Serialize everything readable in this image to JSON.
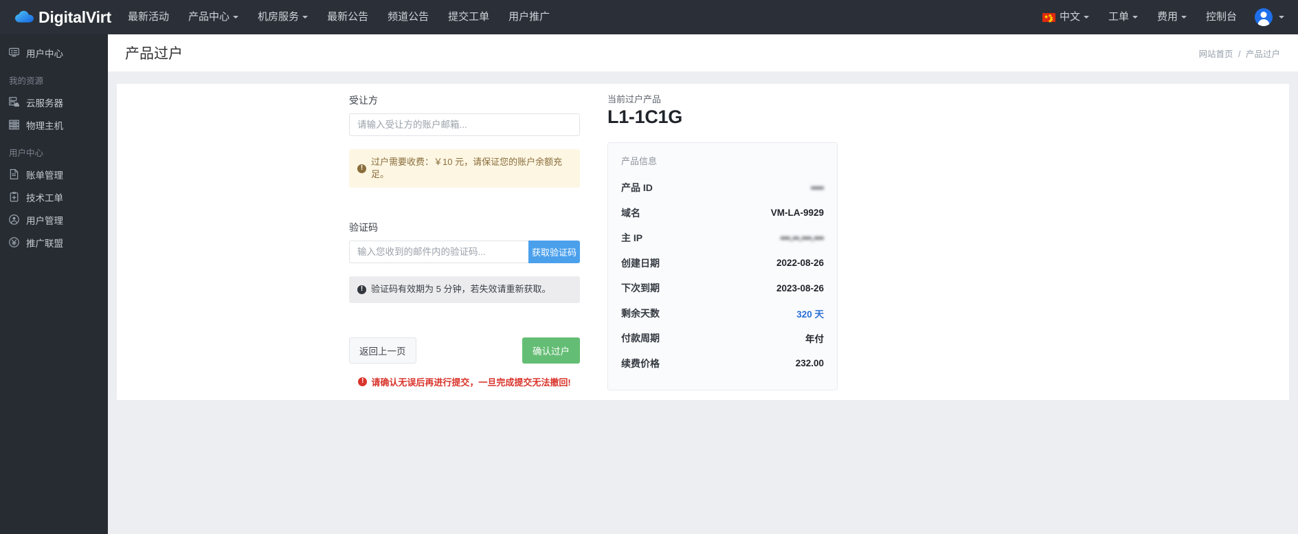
{
  "topnav": {
    "brand": "DigitalVirt",
    "brand_icon": "cloud-icon",
    "links": [
      {
        "label": "最新活动",
        "caret": false
      },
      {
        "label": "产品中心",
        "caret": true
      },
      {
        "label": "机房服务",
        "caret": true
      },
      {
        "label": "最新公告",
        "caret": false
      },
      {
        "label": "频道公告",
        "caret": false
      },
      {
        "label": "提交工单",
        "caret": false
      },
      {
        "label": "用户推广",
        "caret": false
      }
    ],
    "right": [
      {
        "label": "中文",
        "caret": true,
        "flag": true
      },
      {
        "label": "工单",
        "caret": true,
        "flag": false
      },
      {
        "label": "费用",
        "caret": true,
        "flag": false
      },
      {
        "label": "控制台",
        "caret": false,
        "flag": false
      }
    ],
    "avatar_caret": true,
    "bg_color": "#2b3038"
  },
  "sidebar": {
    "bg_color": "#272c33",
    "entries": [
      {
        "type": "item",
        "label": "用户中心",
        "icon": "display-icon"
      },
      {
        "type": "group",
        "label": "我的资源"
      },
      {
        "type": "item",
        "label": "云服务器",
        "icon": "cloud-server-icon"
      },
      {
        "type": "item",
        "label": "物理主机",
        "icon": "server-rack-icon"
      },
      {
        "type": "group",
        "label": "用户中心"
      },
      {
        "type": "item",
        "label": "账单管理",
        "icon": "file-text-icon"
      },
      {
        "type": "item",
        "label": "技术工单",
        "icon": "clipboard-plus-icon"
      },
      {
        "type": "item",
        "label": "用户管理",
        "icon": "user-circle-icon"
      },
      {
        "type": "item",
        "label": "推广联盟",
        "icon": "yen-circle-icon"
      }
    ]
  },
  "page": {
    "title": "产品过户",
    "breadcrumb": {
      "home": "网站首页",
      "separator": "/",
      "current": "产品过户"
    }
  },
  "form": {
    "recipient_label": "受让方",
    "recipient_placeholder": "请输入受让方的账户邮箱...",
    "recipient_value": "",
    "fee_alert": "过户需要收费：￥10 元，请保证您的账户余额充足。",
    "captcha_label": "验证码",
    "captcha_placeholder": "输入您收到的邮件内的验证码...",
    "captcha_value": "",
    "get_code_button": "获取验证码",
    "captcha_info": "验证码有效期为 5 分钟，若失效请重新获取。",
    "back_button": "返回上一页",
    "confirm_button": "确认过户",
    "danger_note": "请确认无误后再进行提交，一旦完成提交无法撤回!",
    "code_button_color": "#4ba0ec",
    "confirm_button_color": "#64bd74",
    "danger_color": "#d9342b"
  },
  "product": {
    "kicker": "当前过户产品",
    "name": "L1-1C1G",
    "box_title": "产品信息",
    "rows": [
      {
        "key": "产品 ID",
        "value": "••••",
        "redacted": true,
        "link": false
      },
      {
        "key": "域名",
        "value": "VM-LA-9929",
        "redacted": false,
        "link": false
      },
      {
        "key": "主 IP",
        "value": "•••.••.•••.•••",
        "redacted": true,
        "link": false
      },
      {
        "key": "创建日期",
        "value": "2022-08-26",
        "redacted": false,
        "link": false
      },
      {
        "key": "下次到期",
        "value": "2023-08-26",
        "redacted": false,
        "link": false
      },
      {
        "key": "剩余天数",
        "value": "320 天",
        "redacted": false,
        "link": true
      },
      {
        "key": "付款周期",
        "value": "年付",
        "redacted": false,
        "link": false
      },
      {
        "key": "续费价格",
        "value": "232.00",
        "redacted": false,
        "link": false
      }
    ],
    "link_color": "#2a6fd6"
  }
}
